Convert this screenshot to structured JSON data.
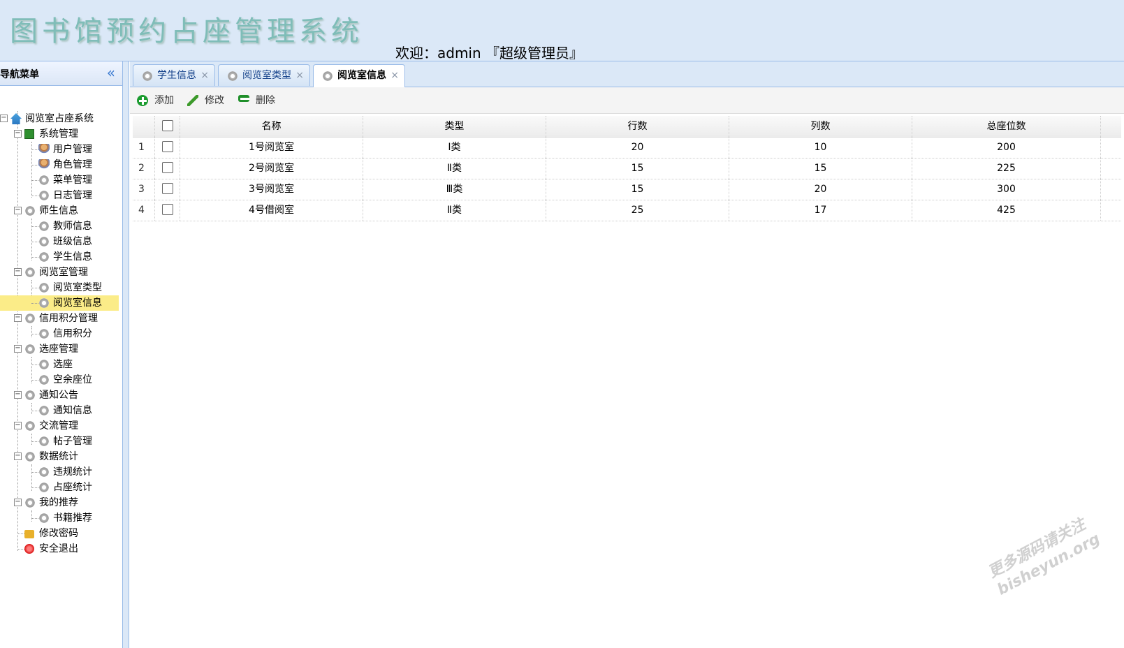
{
  "header": {
    "app_title": "图书馆预约占座管理系统",
    "welcome": "欢迎：admin 『超级管理员』"
  },
  "sidebar": {
    "title": "导航菜单",
    "collapse_icon": "double-chevron-left-icon",
    "tree": [
      {
        "label": "阅览室占座系统",
        "icon": "home-icon"
      },
      {
        "label": "系统管理",
        "icon": "green-square-icon"
      },
      {
        "label": "用户管理",
        "icon": "user-icon"
      },
      {
        "label": "角色管理",
        "icon": "users-icon"
      },
      {
        "label": "菜单管理",
        "icon": "menu-icon"
      },
      {
        "label": "日志管理",
        "icon": "gear-icon"
      },
      {
        "label": "师生信息",
        "icon": "gear-icon"
      },
      {
        "label": "教师信息",
        "icon": "gear-icon"
      },
      {
        "label": "班级信息",
        "icon": "gear-icon"
      },
      {
        "label": "学生信息",
        "icon": "gear-icon"
      },
      {
        "label": "阅览室管理",
        "icon": "gear-icon"
      },
      {
        "label": "阅览室类型",
        "icon": "gear-icon"
      },
      {
        "label": "阅览室信息",
        "icon": "gear-icon"
      },
      {
        "label": "信用积分管理",
        "icon": "gear-icon"
      },
      {
        "label": "信用积分",
        "icon": "gear-icon"
      },
      {
        "label": "选座管理",
        "icon": "gear-icon"
      },
      {
        "label": "选座",
        "icon": "gear-icon"
      },
      {
        "label": "空余座位",
        "icon": "gear-icon"
      },
      {
        "label": "通知公告",
        "icon": "gear-icon"
      },
      {
        "label": "通知信息",
        "icon": "gear-icon"
      },
      {
        "label": "交流管理",
        "icon": "gear-icon"
      },
      {
        "label": "帖子管理",
        "icon": "gear-icon"
      },
      {
        "label": "数据统计",
        "icon": "gear-icon"
      },
      {
        "label": "违规统计",
        "icon": "gear-icon"
      },
      {
        "label": "占座统计",
        "icon": "gear-icon"
      },
      {
        "label": "我的推荐",
        "icon": "gear-icon"
      },
      {
        "label": "书籍推荐",
        "icon": "gear-icon"
      },
      {
        "label": "修改密码",
        "icon": "lock-icon"
      },
      {
        "label": "安全退出",
        "icon": "exit-icon"
      }
    ]
  },
  "tabs": [
    {
      "label": "学生信息",
      "close": "×"
    },
    {
      "label": "阅览室类型",
      "close": "×"
    },
    {
      "label": "阅览室信息",
      "close": "×"
    }
  ],
  "toolbar": {
    "add_label": "添加",
    "edit_label": "修改",
    "delete_label": "删除"
  },
  "grid": {
    "columns": [
      "名称",
      "类型",
      "行数",
      "列数",
      "总座位数"
    ],
    "rows": [
      {
        "num": "1",
        "name": "1号阅览室",
        "type": "Ⅰ类",
        "rows": "20",
        "cols": "10",
        "total": "200"
      },
      {
        "num": "2",
        "name": "2号阅览室",
        "type": "Ⅱ类",
        "rows": "15",
        "cols": "15",
        "total": "225"
      },
      {
        "num": "3",
        "name": "3号阅览室",
        "type": "Ⅲ类",
        "rows": "15",
        "cols": "20",
        "total": "300"
      },
      {
        "num": "4",
        "name": "4号借阅室",
        "type": "Ⅱ类",
        "rows": "25",
        "cols": "17",
        "total": "425"
      }
    ]
  },
  "watermark": {
    "line1": "更多源码请关注",
    "line2": "bisheyun.org"
  }
}
